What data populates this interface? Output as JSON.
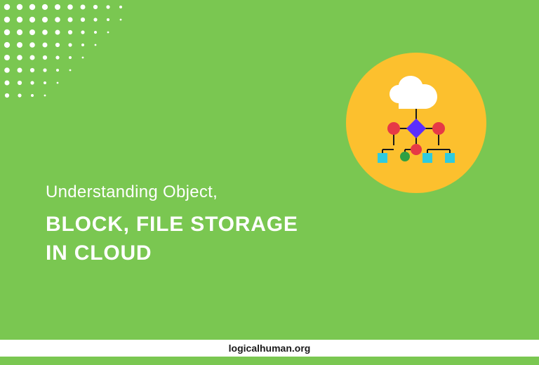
{
  "text": {
    "line1": "Understanding Object,",
    "line2": "BLOCK, FILE STORAGE",
    "line3": "IN CLOUD"
  },
  "footer": {
    "site": "logicalhuman.org"
  },
  "colors": {
    "bg": "#7AC751",
    "circle": "#FCC02E",
    "cloud": "#FFFFFF",
    "diamond": "#5B2EFC",
    "red": "#E63946",
    "green": "#2EA043",
    "cyan": "#2ECBE0",
    "line": "#1a1a1a"
  },
  "decorations": {
    "dotgrid": "white-dots-top-left"
  }
}
